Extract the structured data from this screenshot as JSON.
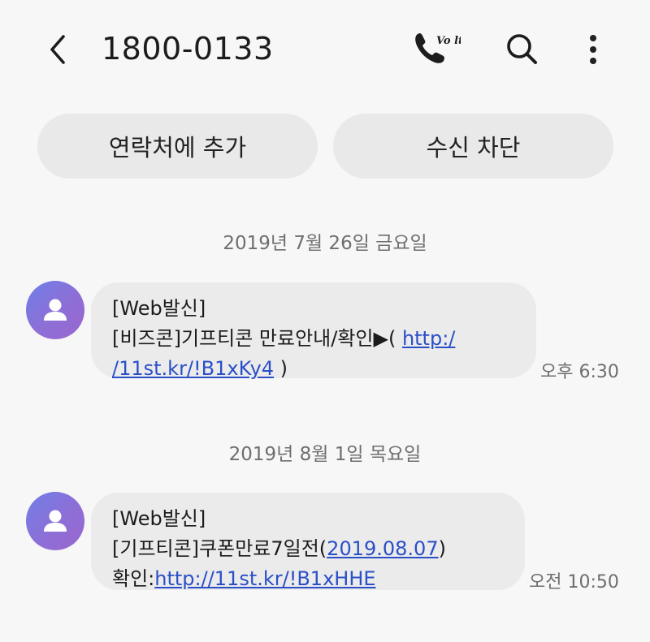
{
  "header": {
    "title": "1800-0133",
    "call_badge": "Vo lte"
  },
  "actions": {
    "add_contact": "연락처에 추가",
    "block": "수신 차단"
  },
  "messages": [
    {
      "date": "2019년 7월 26일 금요일",
      "line1": "[Web발신]",
      "line2_prefix": "[비즈콘]기프티콘 만료안내/확인▶( ",
      "link_a": "http:/",
      "link_b": "/11st.kr/!B1xKy4",
      "line3_suffix": " )",
      "time": "오후 6:30"
    },
    {
      "date": "2019년 8월 1일 목요일",
      "line1": "[Web발신]",
      "line2_prefix": "[기프티콘]쿠폰만료7일전(",
      "date_link": "2019.08.07",
      "line2_suffix": ")",
      "line3_prefix": "확인:",
      "link": "http://11st.kr/!B1xHHE",
      "time": "오전 10:50"
    }
  ]
}
